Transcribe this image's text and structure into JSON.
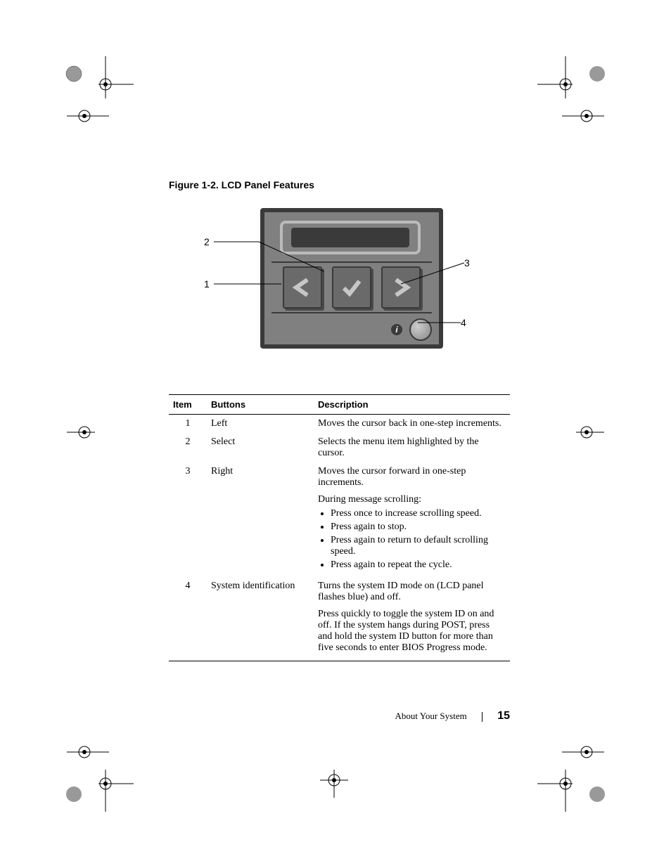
{
  "figure": {
    "caption": "Figure 1-2.   LCD Panel Features",
    "callouts": {
      "1": "1",
      "2": "2",
      "3": "3",
      "4": "4"
    }
  },
  "table": {
    "headers": {
      "item": "Item",
      "buttons": "Buttons",
      "description": "Description"
    },
    "rows": [
      {
        "item": "1",
        "button": "Left",
        "desc_paras": [
          "Moves the cursor back in one-step increments."
        ],
        "bullets": []
      },
      {
        "item": "2",
        "button": "Select",
        "desc_paras": [
          "Selects the menu item highlighted by the cursor."
        ],
        "bullets": []
      },
      {
        "item": "3",
        "button": "Right",
        "desc_paras": [
          "Moves the cursor forward in one-step increments.",
          "During message scrolling:"
        ],
        "bullets": [
          "Press once to increase scrolling speed.",
          "Press again to stop.",
          "Press again to return to default scrolling speed.",
          "Press again to repeat the cycle."
        ]
      },
      {
        "item": "4",
        "button": "System identification",
        "desc_paras": [
          "Turns the system ID mode on (LCD panel flashes blue) and off.",
          "Press quickly to toggle the system ID on and off. If the system hangs during POST, press and hold the system ID button for more than five seconds to enter BIOS Progress mode."
        ],
        "bullets": []
      }
    ]
  },
  "footer": {
    "section": "About Your System",
    "page": "15"
  }
}
